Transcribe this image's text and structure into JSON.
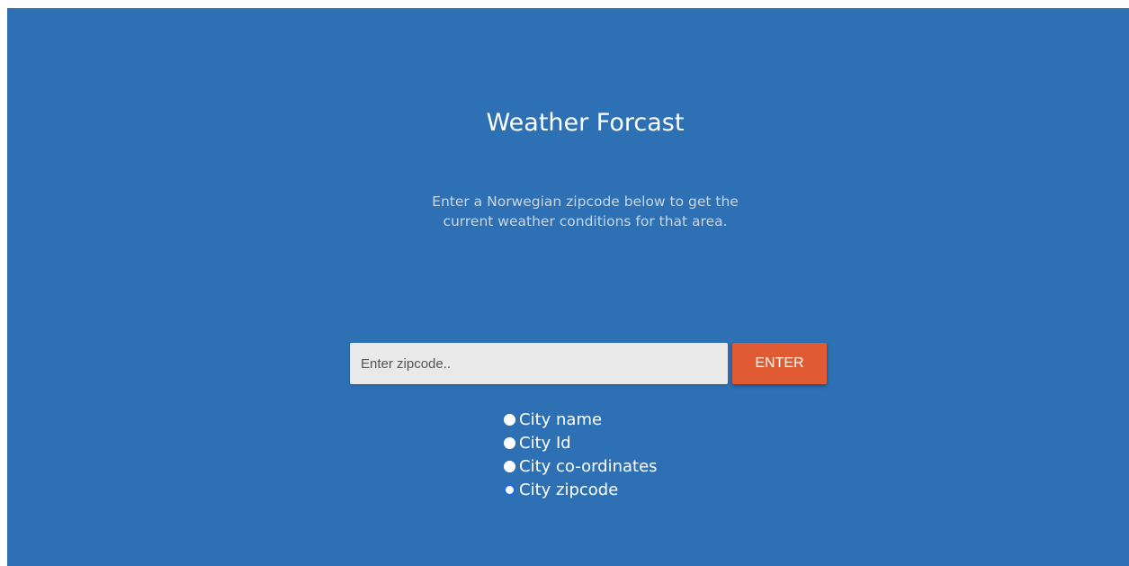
{
  "header": {
    "title": "Weather Forcast"
  },
  "intro": {
    "line1": "Enter a Norwegian zipcode below to get the",
    "line2": "current weather conditions for that area."
  },
  "search": {
    "placeholder": "Enter zipcode..",
    "value": "",
    "button_label": "ENTER"
  },
  "search_type": {
    "options": [
      {
        "label": "City name",
        "checked": false
      },
      {
        "label": "City Id",
        "checked": false
      },
      {
        "label": "City co-ordinates",
        "checked": false
      },
      {
        "label": "City zipcode",
        "checked": true
      }
    ]
  },
  "colors": {
    "background": "#2e70b4",
    "button": "#e05a33",
    "radio_selected": "#1a6cf0"
  }
}
